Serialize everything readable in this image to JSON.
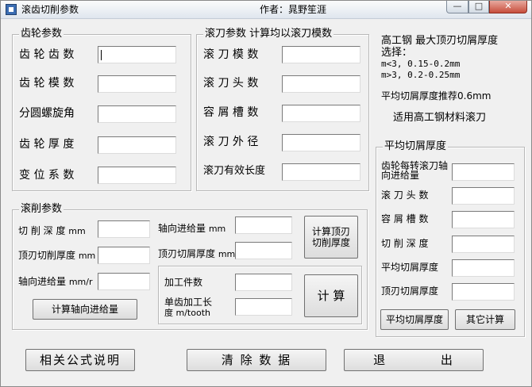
{
  "window": {
    "title": "滚齿切削参数",
    "author": "作者：晁野笙涯",
    "controls": {
      "minimize": "—",
      "maximize": "□",
      "close": "✕"
    }
  },
  "gear": {
    "legend": "齿轮参数",
    "fields": [
      {
        "label": "齿 轮 齿 数",
        "value": ""
      },
      {
        "label": "齿 轮 模 数",
        "value": ""
      },
      {
        "label": "分圆螺旋角",
        "value": ""
      },
      {
        "label": "齿 轮 厚 度",
        "value": ""
      },
      {
        "label": "变 位 系 数",
        "value": ""
      }
    ]
  },
  "hob": {
    "legend": "滚刀参数  计算均以滚刀模数",
    "fields": [
      {
        "label": "滚 刀 模 数",
        "value": ""
      },
      {
        "label": "滚 刀 头 数",
        "value": ""
      },
      {
        "label": "容 屑 槽 数",
        "value": ""
      },
      {
        "label": "滚 刀 外 径",
        "value": ""
      },
      {
        "label": "滚刀有效长度",
        "value": ""
      }
    ]
  },
  "info": {
    "line1": "高工钢 最大顶刃切屑厚度",
    "line2": "选择：",
    "line3": "m<3,  0.15-0.2mm",
    "line4": "m>3,  0.2-0.25mm",
    "line5": "平均切屑厚度推荐0.6mm",
    "line6": "适用高工钢材料滚刀"
  },
  "hobbing": {
    "legend": "滚削参数",
    "cut_depth": "切 削 深 度",
    "cut_depth_unit": "mm",
    "tip_thickness": "顶刃切削厚度",
    "tip_thickness_unit": "mm",
    "axial_feed": "轴向进给量",
    "axial_feed_unit": "mm/r",
    "axial_feed2": "轴向进给量",
    "axial_feed2_unit": "mm",
    "tip_chip": "顶刃切屑厚度",
    "tip_chip_unit": "mm",
    "calc_feed_button": "计算轴向进给量",
    "calc_tip_button_l1": "计算顶刃",
    "calc_tip_button_l2": "切削厚度",
    "workpieces": "加工件数",
    "unit_length_l1": "单齿加工长",
    "unit_length_l2": "度 m/tooth",
    "calc_button": "计 算"
  },
  "avg": {
    "legend": "平均切屑厚度",
    "fields": [
      {
        "label": "齿轮每转滚刀轴向进给量"
      },
      {
        "label": "滚 刀 头 数"
      },
      {
        "label": "容 屑 槽 数"
      },
      {
        "label": "切 削 深 度"
      },
      {
        "label": "平均切屑厚度"
      },
      {
        "label": "顶刃切屑厚度"
      }
    ],
    "avg_button": "平均切屑厚度",
    "other_button": "其它计算"
  },
  "bottom": {
    "formula_button": "相关公式说明",
    "clear_button": "清 除 数 据",
    "exit_button": "退          出"
  }
}
